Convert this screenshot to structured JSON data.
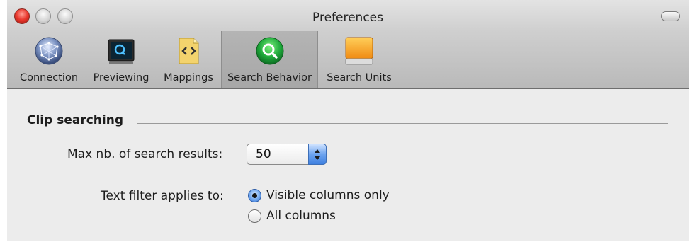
{
  "window": {
    "title": "Preferences"
  },
  "toolbar": {
    "tabs": [
      {
        "label": "Connection",
        "icon": "network-globe-icon",
        "selected": false
      },
      {
        "label": "Previewing",
        "icon": "monitor-icon",
        "selected": false
      },
      {
        "label": "Mappings",
        "icon": "code-document-icon",
        "selected": false
      },
      {
        "label": "Search Behavior",
        "icon": "magnifier-icon",
        "selected": true
      },
      {
        "label": "Search Units",
        "icon": "disk-drive-icon",
        "selected": false
      }
    ]
  },
  "section": {
    "title": "Clip searching"
  },
  "max_results": {
    "label": "Max nb. of search results:",
    "value": "50"
  },
  "text_filter": {
    "label": "Text filter applies to:",
    "options": [
      {
        "label": "Visible columns only",
        "selected": true
      },
      {
        "label": "All columns",
        "selected": false
      }
    ]
  },
  "colors": {
    "accent": "#3f80e0",
    "close": "#e8352b"
  }
}
